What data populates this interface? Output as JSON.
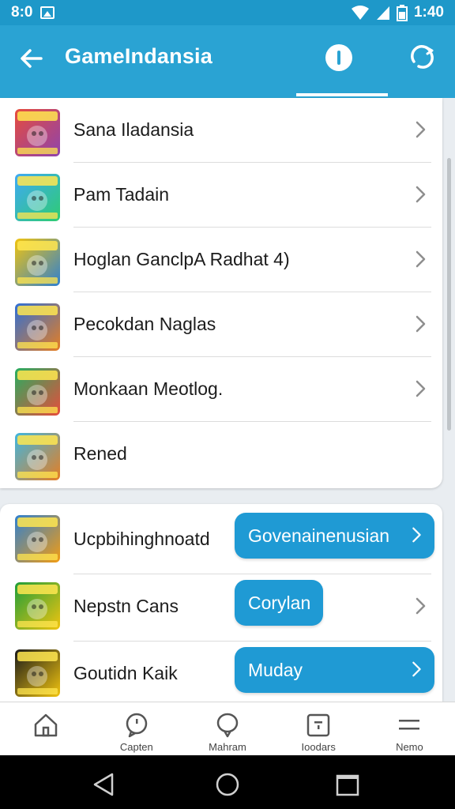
{
  "status_bar": {
    "left_text": "8:0",
    "time": "1:40"
  },
  "app_bar": {
    "title": "GameIndansia"
  },
  "list1": [
    {
      "label": "Sana Iladansia",
      "chevron": true,
      "colors": [
        "#e74c3c",
        "#8e44ad"
      ]
    },
    {
      "label": "Pam Tadain",
      "chevron": true,
      "colors": [
        "#3fa9f5",
        "#2ecc71"
      ]
    },
    {
      "label": "Hoglan GanclpA Radhat 4)",
      "chevron": true,
      "colors": [
        "#f1c40f",
        "#2f80d0"
      ]
    },
    {
      "label": "Pecokdan Naglas",
      "chevron": true,
      "colors": [
        "#2f6fd6",
        "#e67e22"
      ]
    },
    {
      "label": "Monkaan Meotlog.",
      "chevron": true,
      "colors": [
        "#27ae60",
        "#e74c3c"
      ]
    },
    {
      "label": "Rened",
      "chevron": false,
      "colors": [
        "#3fb6e0",
        "#e67e22"
      ]
    }
  ],
  "list2": [
    {
      "label": "Ucpbihinghnoatd",
      "button": "Govenainenusian",
      "button_chevron": true,
      "row_chevron": false,
      "colors": [
        "#2f80d0",
        "#f39c12"
      ]
    },
    {
      "label": "Nepstn Cans",
      "button": "Corylan",
      "button_chevron": false,
      "row_chevron": true,
      "colors": [
        "#1e9e3a",
        "#f1c40f"
      ]
    },
    {
      "label": "Goutidn Kaik",
      "button": "Muday",
      "button_chevron": true,
      "row_chevron": false,
      "colors": [
        "#1a1a1a",
        "#f1c40f"
      ]
    }
  ],
  "bottom_nav": [
    {
      "label": ""
    },
    {
      "label": "Capten"
    },
    {
      "label": "Mahram"
    },
    {
      "label": "Ioodars"
    },
    {
      "label": "Nemo"
    }
  ],
  "theme": {
    "primary": "#2aa3d3",
    "status_bar": "#1e98c9",
    "button": "#1f9ad4"
  }
}
